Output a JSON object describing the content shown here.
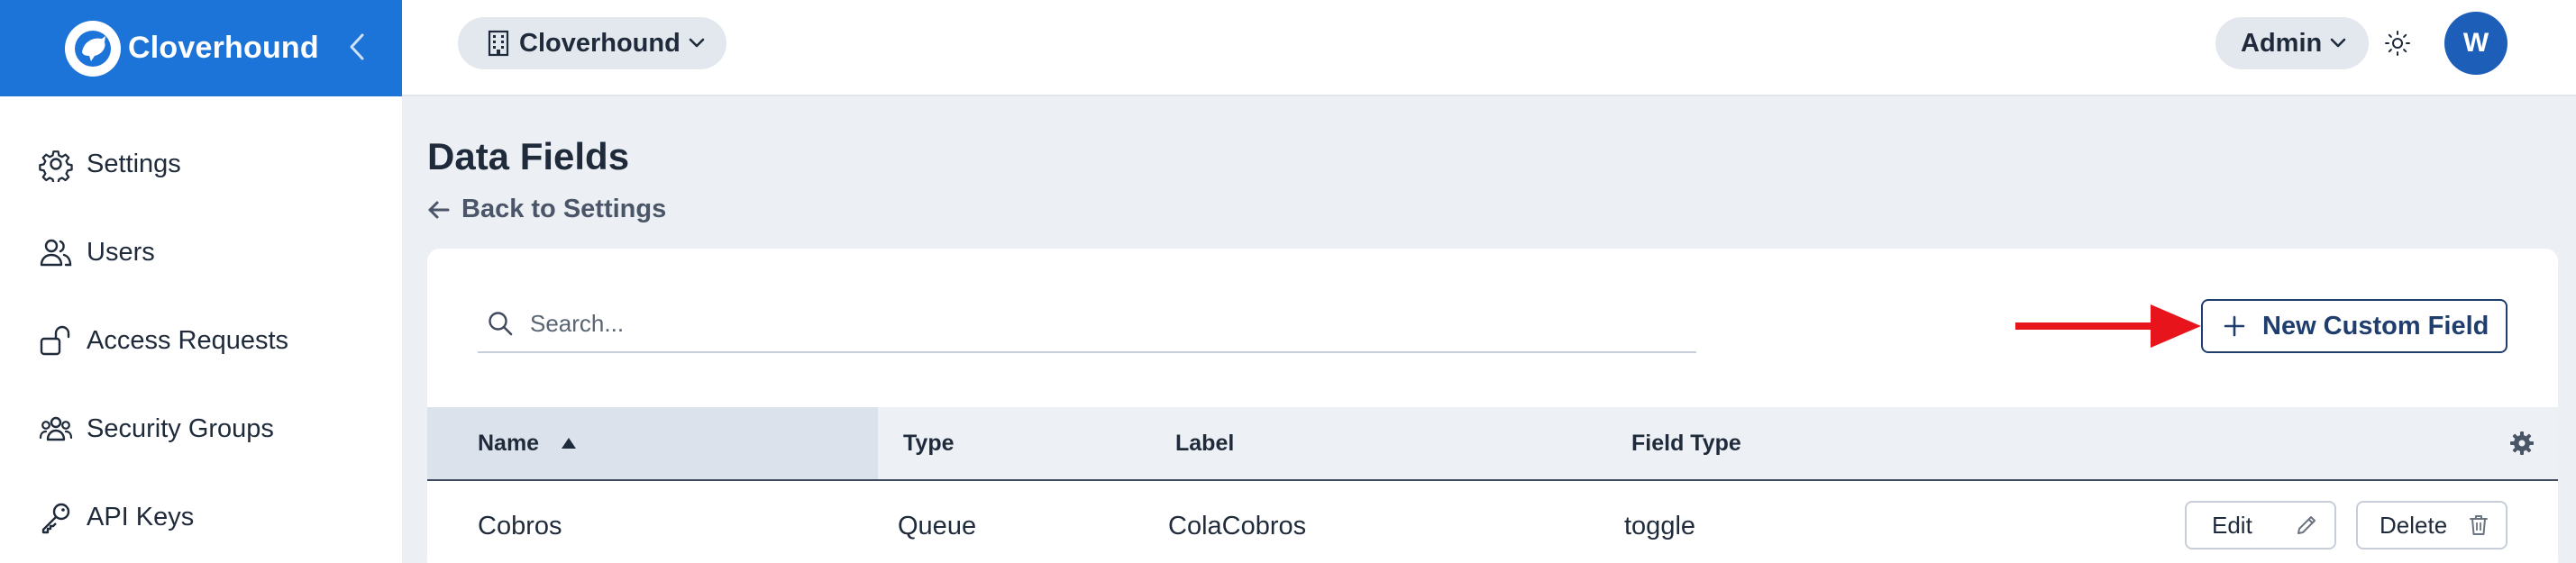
{
  "brand": {
    "name": "Cloverhound"
  },
  "sidebar": {
    "items": [
      {
        "label": "Settings",
        "icon": "gear-icon"
      },
      {
        "label": "Users",
        "icon": "users-icon"
      },
      {
        "label": "Access Requests",
        "icon": "unlock-icon"
      },
      {
        "label": "Security Groups",
        "icon": "group-icon"
      },
      {
        "label": "API Keys",
        "icon": "key-icon"
      }
    ]
  },
  "header": {
    "org_label": "Cloverhound",
    "role_label": "Admin",
    "avatar_initial": "W"
  },
  "page": {
    "title": "Data Fields",
    "back_label": "Back to Settings"
  },
  "toolbar": {
    "search_placeholder": "Search...",
    "new_field_label": "New Custom Field"
  },
  "table": {
    "columns": [
      "Name",
      "Type",
      "Label",
      "Field Type"
    ],
    "sort_column": "Name",
    "sort_direction": "ascending",
    "rows": [
      {
        "name": "Cobros",
        "type": "Queue",
        "label": "ColaCobros",
        "field_type": "toggle",
        "edit_label": "Edit",
        "delete_label": "Delete"
      }
    ]
  },
  "colors": {
    "brand_blue": "#1d74d8",
    "annotation_arrow": "#e8141c",
    "button_navy": "#1f3e6e"
  }
}
